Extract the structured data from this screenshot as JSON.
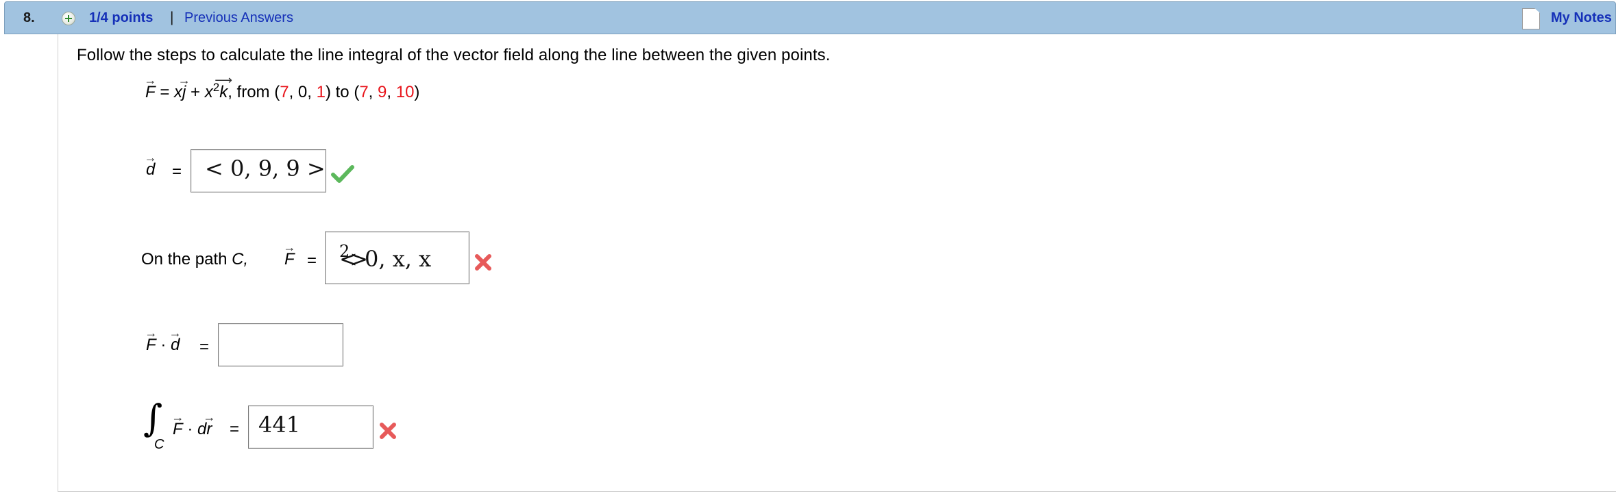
{
  "header": {
    "question_number": "8.",
    "points": "1/4 points",
    "separator": "|",
    "previous_answers": "Previous Answers",
    "my_notes": "My Notes"
  },
  "question": {
    "instruction": "Follow the steps to calculate the line integral of the vector field along the line between the given points.",
    "field": {
      "F": "F",
      "eq": " = ",
      "x1": "x",
      "j": "j",
      "plus": " + ",
      "x2": "x",
      "sup2": "2",
      "k": "k",
      "from_text": ", from (",
      "p1": [
        "7",
        "0",
        "1"
      ],
      "to_text": ") to (",
      "p2": [
        "7",
        "9",
        "10"
      ],
      "close": ")"
    }
  },
  "steps": {
    "d": {
      "label_var": "d",
      "equals": "=",
      "answer": "< 0, 9, 9 >",
      "status": "correct"
    },
    "F_on_path": {
      "label_prefix": "On the path ",
      "label_c": "C,",
      "label_var": "F",
      "equals": "=",
      "answer_left": "< 0, x, x",
      "answer_sup": "2",
      "answer_right": " >",
      "status": "incorrect"
    },
    "F_dot_d": {
      "var1": "F",
      "dot": " · ",
      "var2": "d",
      "equals": "=",
      "answer": "",
      "status": "unanswered"
    },
    "integral": {
      "int_symbol": "∫",
      "subscript": "C",
      "var1": "F",
      "dot": " · ",
      "d": "d",
      "r": "r",
      "equals": "=",
      "answer": "441",
      "status": "incorrect"
    }
  },
  "icons": {
    "plus": "plus-circle-icon",
    "notes": "document-icon",
    "correct": "checkmark-icon",
    "incorrect": "x-mark-icon"
  },
  "colors": {
    "header_bg": "#a1c3e0",
    "link": "#1530b8",
    "highlight_red": "#e8141b",
    "check_green": "#5cb85c",
    "x_red": "#e75a5a"
  }
}
